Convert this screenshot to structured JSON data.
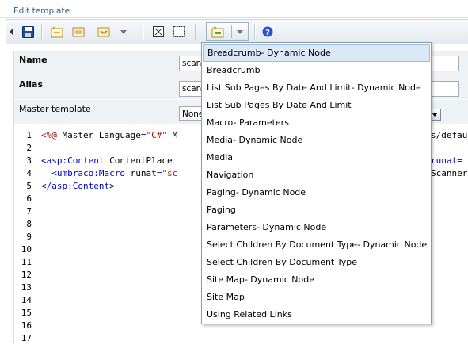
{
  "window": {
    "title": "Edit template"
  },
  "toolbar": {
    "buttons": [
      {
        "name": "save-icon"
      },
      {
        "name": "insert-field-icon"
      },
      {
        "name": "insert-inline-icon"
      },
      {
        "name": "insert-macro-icon"
      },
      {
        "name": "insert-content-area-icon"
      },
      {
        "name": "insert-placeholder-icon"
      },
      {
        "name": "insert-dictionary-icon"
      },
      {
        "name": "help-icon"
      }
    ]
  },
  "properties": {
    "name_label": "Name",
    "name_value": "scann",
    "alias_label": "Alias",
    "alias_value": "scann",
    "master_label": "Master template",
    "master_value": "None"
  },
  "editor": {
    "line_numbers": [
      "1",
      "2",
      "3",
      "4",
      "5",
      "6",
      "7",
      "8",
      "9",
      "10",
      "11",
      "12",
      "13",
      "14",
      "15",
      "16",
      "17"
    ],
    "lines": [
      "<%@ Master Language=\"C#\" M",
      "",
      "<asp:Content ContentPlace",
      "  <umbraco:Macro runat=\"sc",
      "</asp:Content>"
    ],
    "right_fragments": [
      "s/defau",
      "",
      "runat=",
      "Scanner",
      ""
    ]
  },
  "dropdown_menu": {
    "items": [
      "Breadcrumb- Dynamic Node",
      "Breadcrumb",
      "List Sub Pages By Date And Limit- Dynamic Node",
      "List Sub Pages By Date And Limit",
      "Macro- Parameters",
      "Media- Dynamic Node",
      "Media",
      "Navigation",
      "Paging- Dynamic Node",
      "Paging",
      "Parameters- Dynamic Node",
      "Select Children By Document Type- Dynamic Node",
      "Select Children By Document Type",
      "Site Map- Dynamic Node",
      "Site Map",
      "Using Related Links"
    ],
    "highlighted_index": 0
  }
}
